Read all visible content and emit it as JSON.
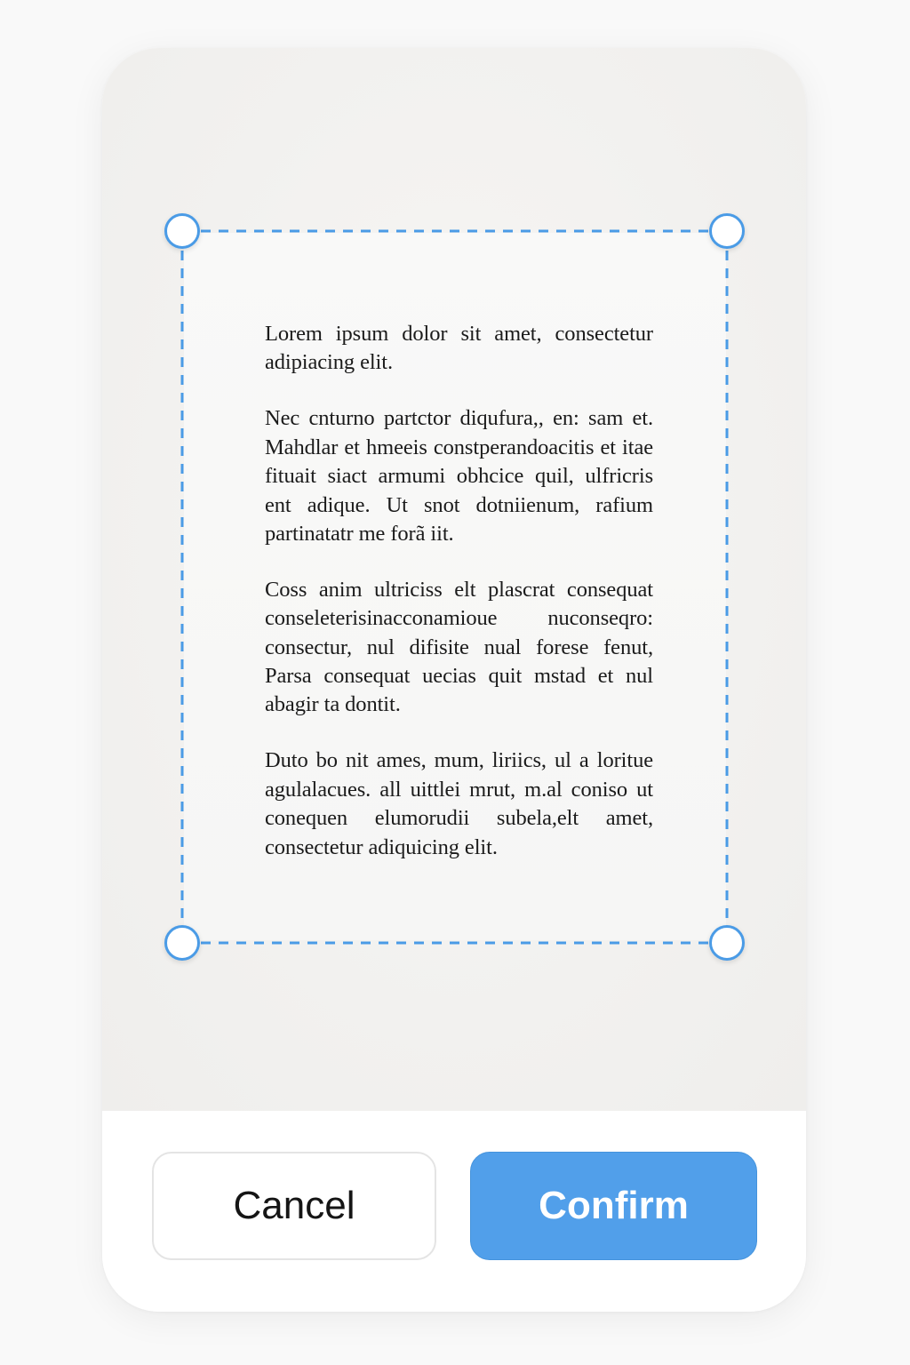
{
  "document": {
    "paragraphs": [
      "Lorem ipsum dolor sit amet, consectetur adipiacing elit.",
      "Nec cnturno partctor diqufura,, en: sam et. Mahdlar et hmeeis constperandoacitis et itae fituait siact armumi obhcice quil, ulfricris ent adique. Ut snot dotniienum, rafium partinatatr me forã iit.",
      "Coss anim ultriciss elt plascrat consequat conseleterisinacconamioue nuconseqro: consectur, nul difisite nual forese fenut, Parsa consequat uecias quit mstad et nul abagir ta dontit.",
      "Duto bo nit ames, mum, liriics, ul a loritue agulalacues. all uittlei mrut, m.al coniso ut conequen elumorudii subela,elt amet, consectetur adiquicing elit."
    ]
  },
  "crop": {
    "handles": [
      "top-left",
      "top-right",
      "bottom-left",
      "bottom-right"
    ],
    "border_style": "dashed",
    "accent_color": "#4a9be6"
  },
  "actions": {
    "cancel_label": "Cancel",
    "confirm_label": "Confirm",
    "confirm_color": "#519fea"
  }
}
